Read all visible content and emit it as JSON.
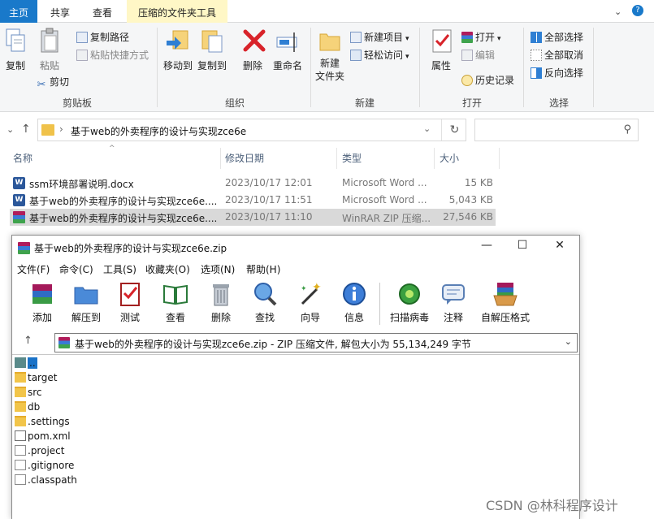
{
  "explorer": {
    "tabs": [
      "主页",
      "共享",
      "查看",
      "压缩的文件夹工具"
    ],
    "groups": {
      "clipboard": {
        "label": "剪贴板",
        "copy": "复制",
        "paste": "粘贴",
        "copy_path": "复制路径",
        "paste_shortcut": "粘贴快捷方式",
        "cut": "剪切"
      },
      "organize": {
        "label": "组织",
        "move_to": "移动到",
        "copy_to": "复制到",
        "delete": "删除",
        "rename": "重命名"
      },
      "new": {
        "label": "新建",
        "new_folder": "新建\n文件夹",
        "new_item": "新建项目",
        "easy_access": "轻松访问"
      },
      "open": {
        "label": "打开",
        "properties": "属性",
        "open": "打开",
        "edit": "编辑",
        "history": "历史记录"
      },
      "select": {
        "label": "选择",
        "select_all": "全部选择",
        "select_none": "全部取消",
        "invert": "反向选择"
      }
    },
    "address": {
      "path": "基于web的外卖程序的设计与实现zce6e"
    },
    "columns": [
      "名称",
      "修改日期",
      "类型",
      "大小"
    ],
    "files": [
      {
        "name": "ssm环境部署说明.docx",
        "date": "2023/10/17 12:01",
        "type": "Microsoft Word ...",
        "size": "15 KB",
        "icon": "word-icon"
      },
      {
        "name": "基于web的外卖程序的设计与实现zce6e....",
        "date": "2023/10/17 11:51",
        "type": "Microsoft Word ...",
        "size": "5,043 KB",
        "icon": "word-icon"
      },
      {
        "name": "基于web的外卖程序的设计与实现zce6e....",
        "date": "2023/10/17 11:10",
        "type": "WinRAR ZIP 压缩...",
        "size": "27,546 KB",
        "icon": "winrar-icon"
      }
    ]
  },
  "winrar": {
    "title": "基于web的外卖程序的设计与实现zce6e.zip",
    "menu": [
      "文件(F)",
      "命令(C)",
      "工具(S)",
      "收藏夹(O)",
      "选项(N)",
      "帮助(H)"
    ],
    "toolbar": [
      "添加",
      "解压到",
      "测试",
      "查看",
      "删除",
      "查找",
      "向导",
      "信息",
      "扫描病毒",
      "注释",
      "自解压格式"
    ],
    "address": "基于web的外卖程序的设计与实现zce6e.zip - ZIP 压缩文件, 解包大小为 55,134,249 字节",
    "items": [
      {
        "name": "..",
        "kind": "up"
      },
      {
        "name": "target",
        "kind": "folder"
      },
      {
        "name": "src",
        "kind": "folder"
      },
      {
        "name": "db",
        "kind": "folder"
      },
      {
        "name": ".settings",
        "kind": "folder"
      },
      {
        "name": "pom.xml",
        "kind": "xml"
      },
      {
        "name": ".project",
        "kind": "file"
      },
      {
        "name": ".gitignore",
        "kind": "file"
      },
      {
        "name": ".classpath",
        "kind": "file"
      }
    ]
  },
  "watermark": "CSDN @林科程序设计",
  "colors": {
    "accent": "#1979ca",
    "compress_tab": "#fff7c6",
    "selection": "#d9d9d9"
  }
}
